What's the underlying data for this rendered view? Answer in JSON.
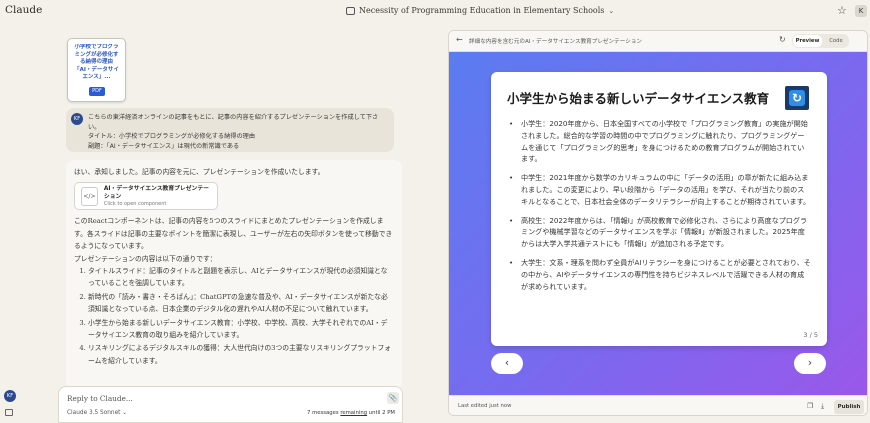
{
  "app": {
    "name": "Claude"
  },
  "header": {
    "title": "Necessity of Programming Education in Elementary Schools",
    "user_initial": "K"
  },
  "attachment": {
    "text": "小学校でプログラミングが必修化する納得の理由「AI・データサイエンス」...",
    "type": "PDF"
  },
  "user_message": {
    "avatar": "KF",
    "lines": [
      "こちらの東洋経済オンラインの記事をもとに、記事の内容を紹介するプレゼンテーションを作成して下さい。",
      "タイトル：小学校でプログラミングが必修化する納得の理由",
      "副題：「AI・データサイエンス」は現代の新常識である"
    ]
  },
  "assistant": {
    "intro": "はい、承知しました。記事の内容を元に、プレゼンテーションを作成いたします。",
    "artifact_title": "AI・データサイエンス教育プレゼンテーション",
    "artifact_sub": "Click to open component",
    "artifact_icon": "</>",
    "para1": "このReactコンポーネントは、記事の内容を5つのスライドにまとめたプレゼンテーションを作成します。各スライドは記事の主要なポイントを簡潔に表現し、ユーザーが左右の矢印ボタンを使って移動できるようになっています。",
    "para2": "プレゼンテーションの内容は以下の通りです：",
    "items": [
      "タイトルスライド：記事のタイトルと副題を表示し、AIとデータサイエンスが現代の必須知識となっていることを強調しています。",
      "新時代の「読み・書き・そろばん」：ChatGPTの急速な普及や、AI・データサイエンスが新たな必須知識となっている点、日本企業のデジタル化の遅れやAI人材の不足について触れています。",
      "小学生から始まる新しいデータサイエンス教育：小学校、中学校、高校、大学それぞれでのAI・データサイエンス教育の取り組みを紹介しています。",
      "リスキリングによるデジタルスキルの獲得：大人世代向けの3つの主要なリスキリングプラットフォームを紹介しています。"
    ]
  },
  "input": {
    "placeholder": "Reply to Claude...",
    "model": "Claude 3.5 Sonnet",
    "remaining_prefix": "7 messages ",
    "remaining_link": "remaining",
    "remaining_suffix": " until 2 PM",
    "user_avatar": "KF"
  },
  "artifact_panel": {
    "title": "詳細な内容を含む元のAI・データサイエンス教育プレゼンテーション",
    "tab_preview": "Preview",
    "tab_code": "Code",
    "slide": {
      "title": "小学生から始まる新しいデータサイエンス教育",
      "bullets": [
        "小学生：2020年度から、日本全国すべての小学校で「プログラミング教育」の実施が開始されました。総合的な学習の時間の中でプログラミングに触れたり、プログラミングゲームを通じて「プログラミング的思考」を身につけるための教育プログラムが開始されています。",
        "中学生：2021年度から数学のカリキュラムの中に「データの活用」の章が新たに組み込まれました。この変更により、早い段階から「データの活用」を学び、それが当たり前のスキルとなることで、日本社会全体のデータリテラシーが向上することが期待されています。",
        "高校生：2022年度からは、「情報Ⅰ」が高校教育で必修化され、さらにより高度なプログラミングや機械学習などのデータサイエンスを学ぶ「情報Ⅱ」が新設されました。2025年度からは大学入学共通テストにも「情報Ⅰ」が追加される予定です。",
        "大学生：文系・理系を問わず全員がAIリテラシーを身につけることが必要とされており、その中から、AIやデータサイエンスの専門性を持ちビジネスレベルで活躍できる人材の育成が求められています。"
      ],
      "page": "3 / 5"
    },
    "footer": {
      "edited": "Last edited just now",
      "publish": "Publish"
    }
  }
}
